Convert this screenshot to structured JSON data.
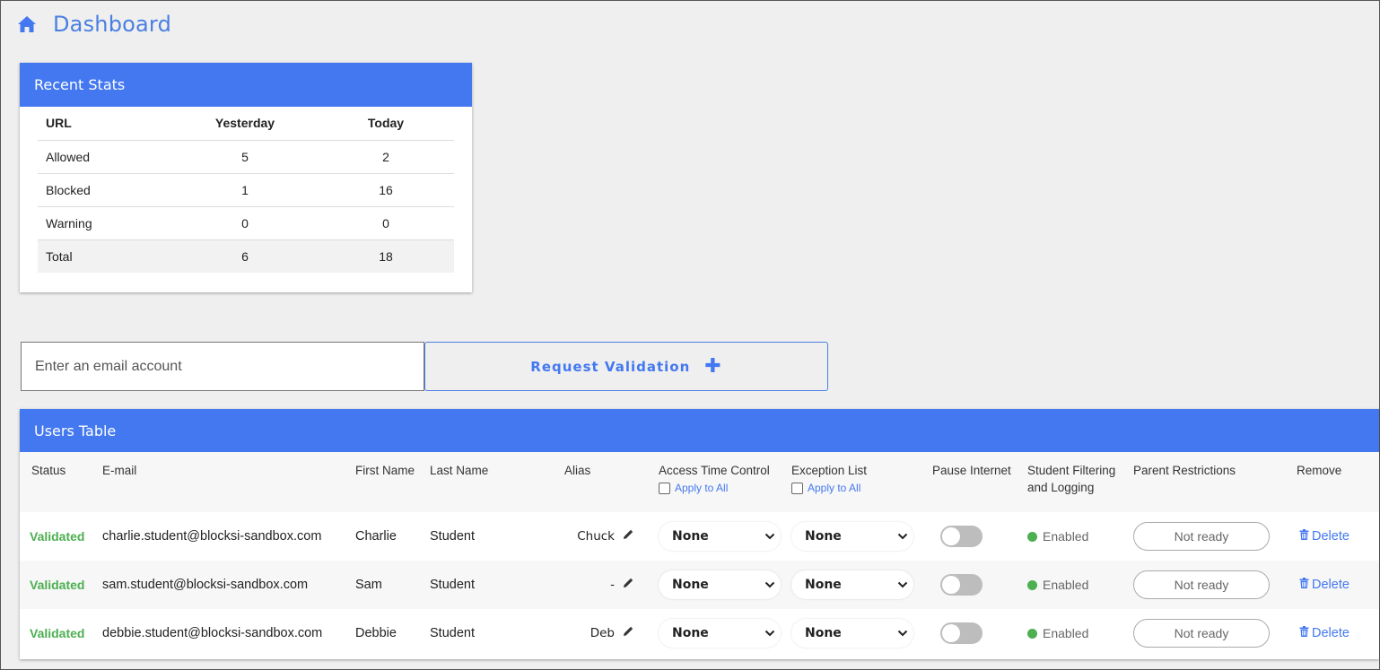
{
  "header": {
    "title": "Dashboard",
    "icon": "home-icon"
  },
  "colors": {
    "accent": "#4378f0",
    "validated": "#4caf50"
  },
  "stats": {
    "title": "Recent Stats",
    "headers": [
      "URL",
      "Yesterday",
      "Today"
    ],
    "rows": [
      [
        "Allowed",
        "5",
        "2"
      ],
      [
        "Blocked",
        "1",
        "16"
      ],
      [
        "Warning",
        "0",
        "0"
      ],
      [
        "Total",
        "6",
        "18"
      ]
    ]
  },
  "email": {
    "placeholder": "Enter an email account",
    "value": ""
  },
  "request_button": {
    "label": "Request Validation",
    "icon": "plus-icon"
  },
  "users": {
    "title": "Users Table",
    "headers": {
      "status": "Status",
      "email": "E-mail",
      "first_name": "First Name",
      "last_name": "Last Name",
      "alias": "Alias",
      "access_time": "Access Time Control",
      "exception": "Exception List",
      "pause": "Pause Internet",
      "filtering_line1": "Student Filtering",
      "filtering_line2": "and Logging",
      "parent": "Parent Restrictions",
      "remove": "Remove",
      "apply_all": "Apply to All"
    },
    "rows": [
      {
        "status": "Validated",
        "email": "charlie.student@blocksi-sandbox.com",
        "first": "Charlie",
        "last": "Student",
        "alias": "Chuck",
        "access": "None",
        "exception": "None",
        "pause": false,
        "filtering": "Enabled",
        "parent": "Not ready",
        "remove": "Delete"
      },
      {
        "status": "Validated",
        "email": "sam.student@blocksi-sandbox.com",
        "first": "Sam",
        "last": "Student",
        "alias": "-",
        "access": "None",
        "exception": "None",
        "pause": false,
        "filtering": "Enabled",
        "parent": "Not ready",
        "remove": "Delete"
      },
      {
        "status": "Validated",
        "email": "debbie.student@blocksi-sandbox.com",
        "first": "Debbie",
        "last": "Student",
        "alias": "Deb",
        "access": "None",
        "exception": "None",
        "pause": false,
        "filtering": "Enabled",
        "parent": "Not ready",
        "remove": "Delete"
      }
    ]
  }
}
